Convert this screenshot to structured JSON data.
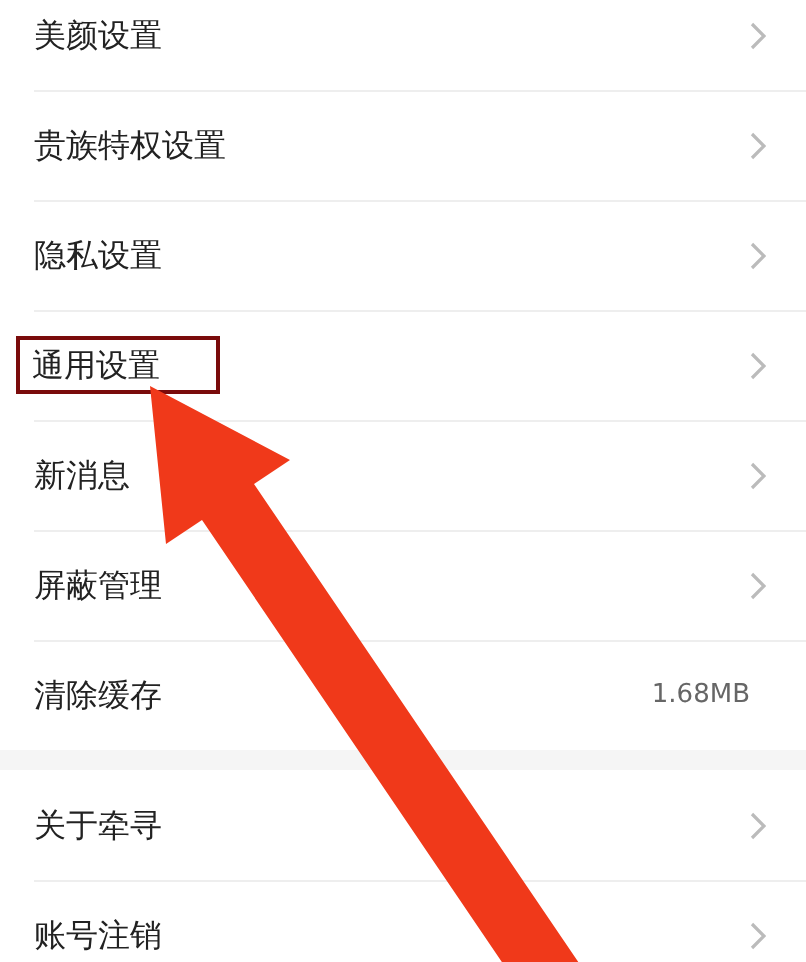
{
  "groups": [
    {
      "rows": [
        {
          "label": "美颜设置",
          "highlighted": false
        },
        {
          "label": "贵族特权设置",
          "highlighted": false
        },
        {
          "label": "隐私设置",
          "highlighted": false
        },
        {
          "label": "通用设置",
          "highlighted": true
        },
        {
          "label": "新消息",
          "highlighted": false
        },
        {
          "label": "屏蔽管理",
          "highlighted": false
        },
        {
          "label": "清除缓存",
          "value": "1.68MB",
          "highlighted": false
        }
      ]
    },
    {
      "rows": [
        {
          "label": "关于牵寻",
          "highlighted": false
        },
        {
          "label": "账号注销",
          "highlighted": false
        }
      ]
    }
  ]
}
